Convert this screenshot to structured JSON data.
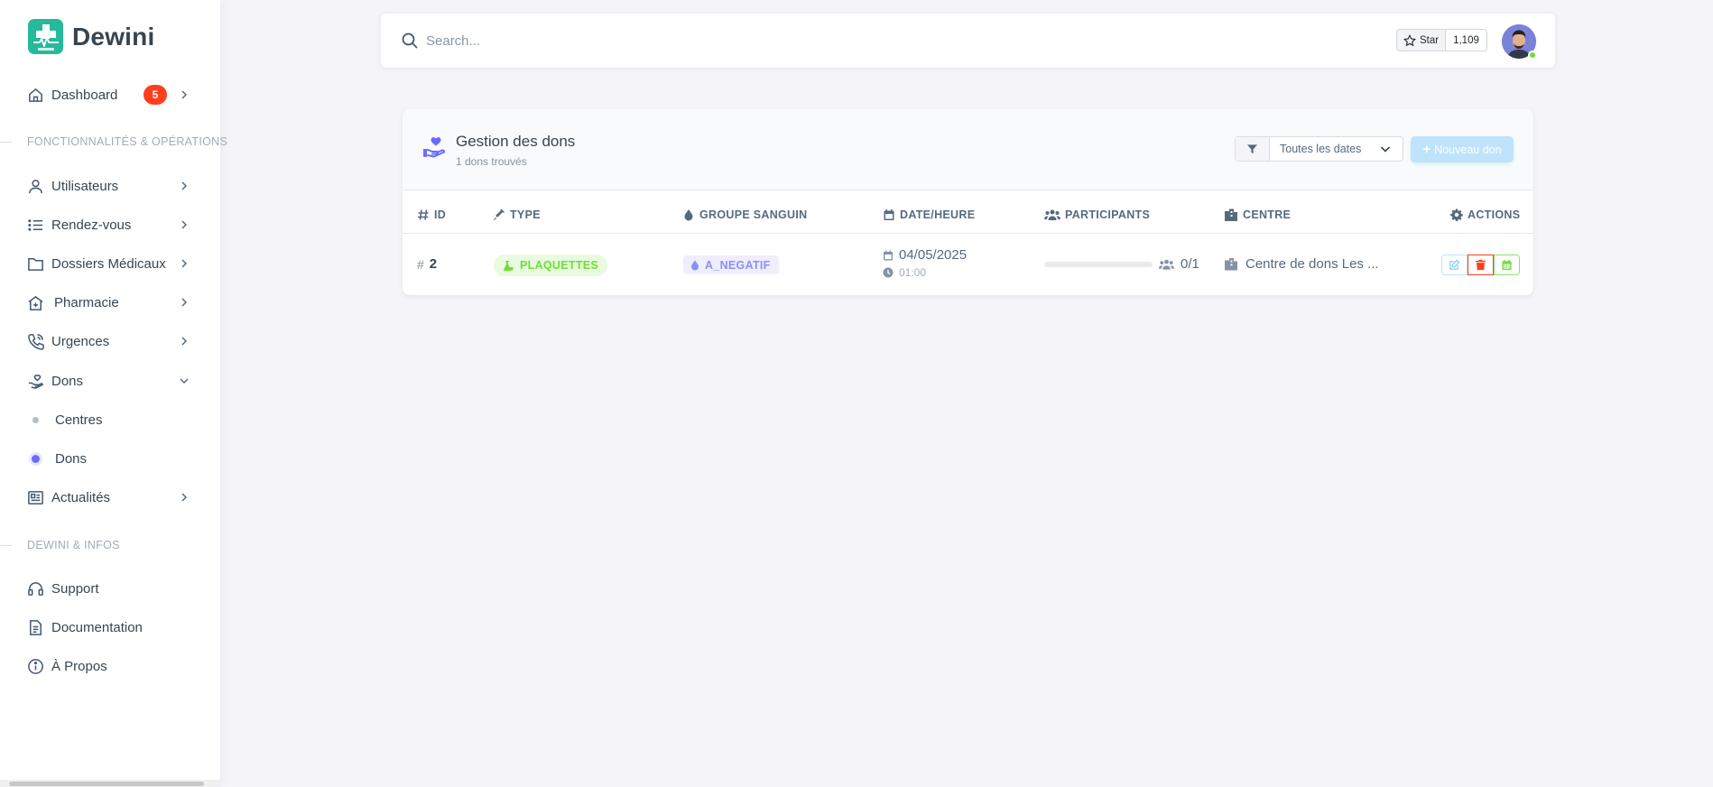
{
  "brand": {
    "name": "Dewini",
    "logo_icon": "medical-cross-heartbeat-icon"
  },
  "sidebar": {
    "dashboard": {
      "label": "Dashboard",
      "badge": "5",
      "icon": "home-icon"
    },
    "section1": "FONCTIONNALITÉS & OPÉRATIONS",
    "items": [
      {
        "label": "Utilisateurs",
        "icon": "user-icon"
      },
      {
        "label": "Rendez-vous",
        "icon": "list-icon"
      },
      {
        "label": "Dossiers Médicaux",
        "icon": "folder-icon"
      },
      {
        "label": "Pharmacie",
        "icon": "pharmacy-home-icon"
      },
      {
        "label": "Urgences",
        "icon": "phone-icon"
      },
      {
        "label": "Dons",
        "icon": "hand-donation-icon"
      }
    ],
    "dons_sub": [
      {
        "label": "Centres"
      },
      {
        "label": "Dons"
      }
    ],
    "actualites": {
      "label": "Actualités",
      "icon": "newspaper-icon"
    },
    "section2": "DEWINI & INFOS",
    "info_items": [
      {
        "label": "Support",
        "icon": "headset-icon"
      },
      {
        "label": "Documentation",
        "icon": "document-icon"
      },
      {
        "label": "À Propos",
        "icon": "info-icon"
      }
    ]
  },
  "navbar": {
    "search_placeholder": "Search...",
    "star_label": "Star",
    "star_count": "1,109"
  },
  "card": {
    "title": "Gestion des dons",
    "subtitle": "1 dons trouvés",
    "filter_select": "Toutes les dates",
    "new_button": "Nouveau don",
    "columns": [
      "ID",
      "TYPE",
      "GROUPE SANGUIN",
      "DATE/HEURE",
      "PARTICIPANTS",
      "CENTRE",
      "ACTIONS"
    ],
    "rows": [
      {
        "id": "2",
        "type": "PLAQUETTES",
        "blood_group": "A_NEGATIF",
        "date": "04/05/2025",
        "time": "01:00",
        "participants": "0/1",
        "participants_progress": 0,
        "centre": "Centre de dons Les ..."
      }
    ]
  },
  "colors": {
    "primary": "#696cff",
    "success": "#71dd37",
    "danger": "#ff3e1d",
    "info": "#bfe3fb"
  }
}
